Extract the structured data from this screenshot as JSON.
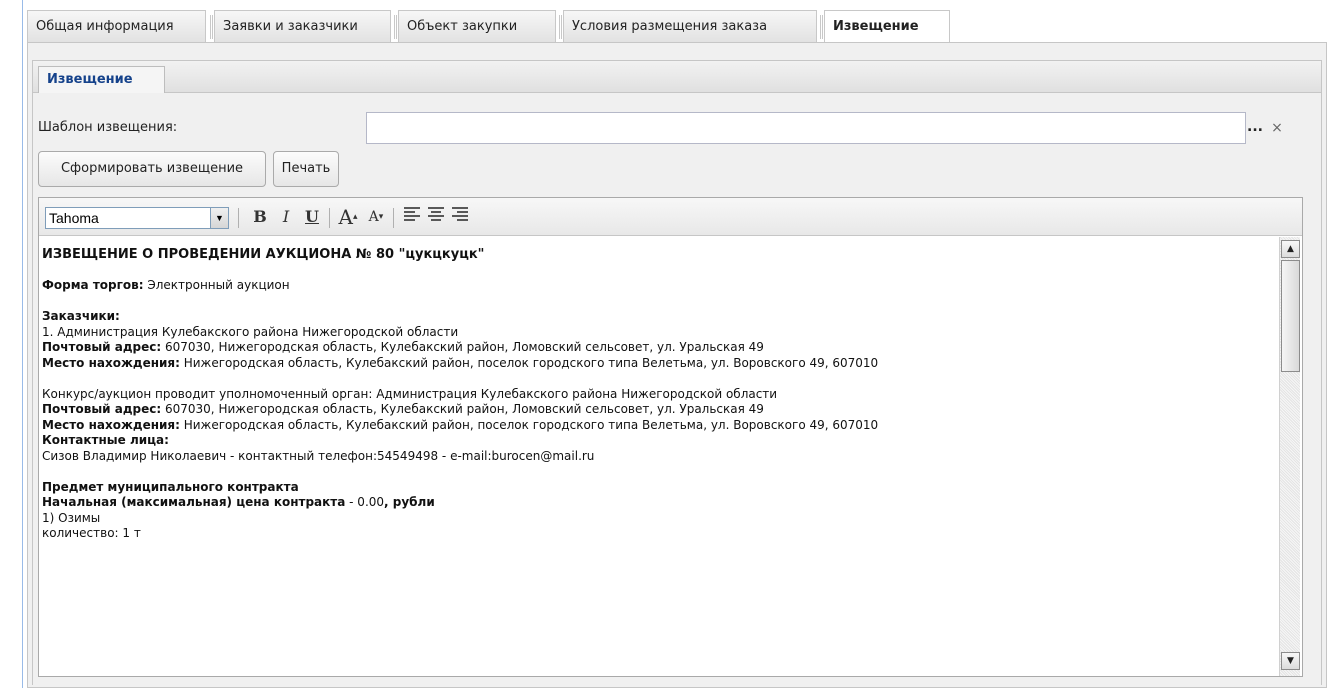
{
  "tabs": [
    {
      "label": "Общая информация",
      "active": false
    },
    {
      "label": "Заявки и заказчики",
      "active": false
    },
    {
      "label": "Объект закупки",
      "active": false
    },
    {
      "label": "Условия размещения заказа",
      "active": false
    },
    {
      "label": "Извещение",
      "active": true
    }
  ],
  "subtab": {
    "label": "Извещение"
  },
  "template": {
    "label": "Шаблон извещения:",
    "value": "",
    "browse": "...",
    "clear": "×"
  },
  "buttons": {
    "generate": "Сформировать извещение",
    "print": "Печать"
  },
  "toolbar": {
    "font": "Tahoma",
    "bold": "B",
    "italic": "I",
    "underline": "U",
    "grow": "A",
    "shrink": "A"
  },
  "doc": {
    "title": "ИЗВЕЩЕНИЕ О ПРОВЕДЕНИИ АУКЦИОНА № 80 \"цукцкуцк\"",
    "form_label": "Форма торгов:",
    "form_value": " Электронный аукцион",
    "customers_heading": "Заказчики:",
    "customer1": "1. Администрация Кулебакского района Нижегородской области",
    "postal_label": "Почтовый адрес:",
    "postal_value": " 607030, Нижегородская область, Кулебакский район, Ломовский сельсовет, ул. Уральская 49",
    "location_label": "Место нахождения:",
    "location_value": " Нижегородская область, Кулебакский район, поселок городского типа Велетьма, ул. Воровского 49, 607010",
    "organizer": "Конкурс/аукцион проводит уполномоченный орган: Администрация Кулебакского района Нижегородской области",
    "contacts_heading": "Контактные лица:",
    "contact": "Сизов Владимир Николаевич - контактный телефон:54549498 - e-mail:burocen@mail.ru",
    "subject_heading": "Предмет муниципального контракта",
    "price_label": "Начальная (максимальная) цена контракта",
    "price_value": " - 0.00",
    "price_unit": ", рубли",
    "item1": "1) Озимы",
    "qty": "количество: 1 т"
  },
  "scroll": {
    "up": "▲",
    "down": "▼"
  }
}
